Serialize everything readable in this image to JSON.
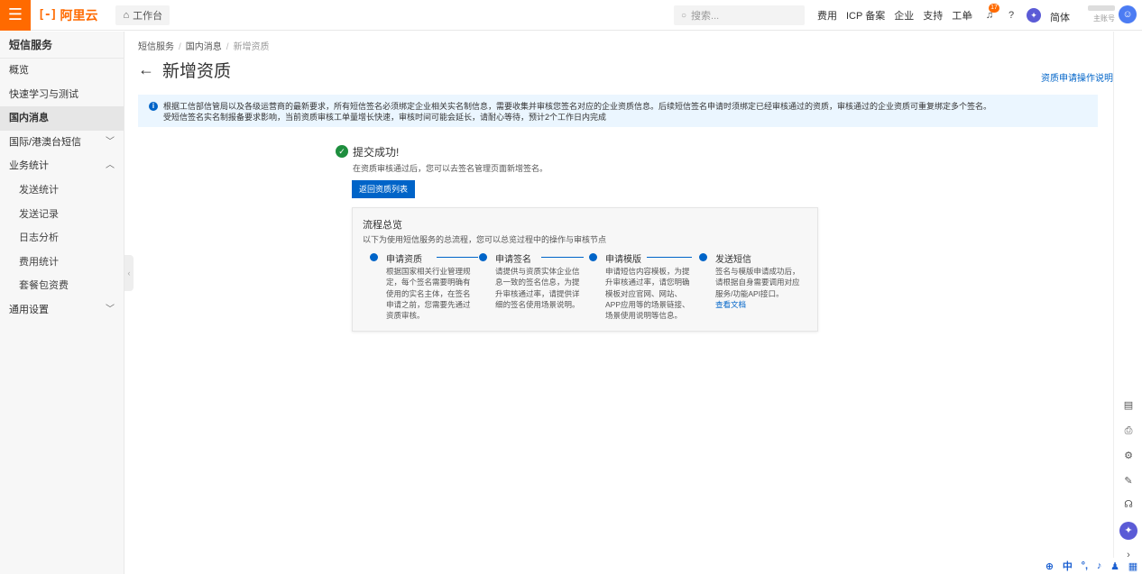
{
  "header": {
    "brand": "阿里云",
    "brand_mark": "[-]",
    "workbench": "工作台",
    "search_placeholder": "搜索...",
    "links": [
      "费用",
      "ICP 备案",
      "企业",
      "支持",
      "工单"
    ],
    "notification_count": "17",
    "language": "简体",
    "account_label": "主账号"
  },
  "sidebar": {
    "title": "短信服务",
    "items": [
      {
        "label": "概览"
      },
      {
        "label": "快速学习与测试"
      },
      {
        "label": "国内消息"
      },
      {
        "label": "国际/港澳台短信"
      },
      {
        "label": "业务统计"
      },
      {
        "label": "发送统计"
      },
      {
        "label": "发送记录"
      },
      {
        "label": "日志分析"
      },
      {
        "label": "费用统计"
      },
      {
        "label": "套餐包资费"
      },
      {
        "label": "通用设置"
      }
    ]
  },
  "breadcrumb": [
    "短信服务",
    "国内消息",
    "新增资质"
  ],
  "page": {
    "title": "新增资质",
    "help_link": "资质申请操作说明"
  },
  "notice": {
    "line1": "根据工信部信管局以及各级运营商的最新要求，所有短信签名必须绑定企业相关实名制信息，需要收集并审核您签名对应的企业资质信息。后续短信签名申请时须绑定已经审核通过的资质，审核通过的企业资质可重复绑定多个签名。",
    "line2": "受短信签名实名制报备要求影响，当前资质审核工单量增长快速，审核时间可能会延长，请耐心等待，预计2个工作日内完成"
  },
  "success": {
    "title": "提交成功!",
    "desc": "在资质审核通过后，您可以去签名管理页面新增签名。",
    "button": "返回资质列表"
  },
  "flow": {
    "title": "流程总览",
    "desc": "以下为使用短信服务的总流程，您可以总览过程中的操作与审核节点",
    "steps": [
      {
        "name": "申请资质",
        "text": "根据国家相关行业管理规定，每个签名需要明确有使用的实名主体，在签名申请之前，您需要先通过资质审核。"
      },
      {
        "name": "申请签名",
        "text": "请提供与资质实体企业信息一致的签名信息，为提升审核通过率，请提供详细的签名使用场景说明。"
      },
      {
        "name": "申请模版",
        "text": "申请短信内容模板，为提升审核通过率，请您明确模板对应官网、网站、APP应用等的场景链接、场景使用说明等信息。"
      },
      {
        "name": "发送短信",
        "text": "签名与模版申请成功后，请根据自身需要调用对应服务/功能API接口。",
        "link": "查看文档"
      }
    ]
  },
  "ime": {
    "mode": "中"
  }
}
